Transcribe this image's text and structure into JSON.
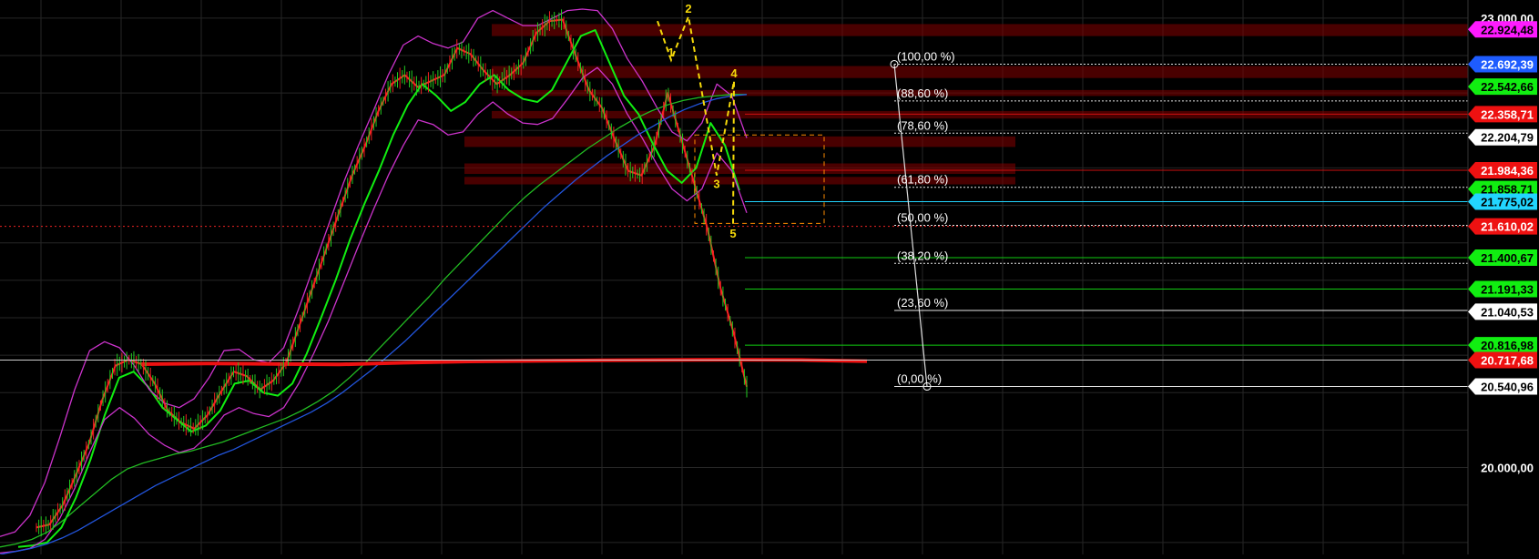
{
  "chart_data": {
    "type": "line",
    "title": "",
    "xlabel": "",
    "ylabel": "",
    "ylim": [
      19420,
      23060
    ],
    "grid": true,
    "axis_ticks": [
      {
        "value": 23000.0,
        "label": "23.000,00"
      },
      {
        "value": 20000.0,
        "label": "20.000,00"
      }
    ],
    "price_tags": [
      {
        "value": 22924.48,
        "label": "22.924,48",
        "bg": "#ff1aff",
        "fg": "#000000"
      },
      {
        "value": 22692.39,
        "label": "22.692,39",
        "bg": "#1e5cff",
        "fg": "#ffffff"
      },
      {
        "value": 22542.66,
        "label": "22.542,66",
        "bg": "#11ee11",
        "fg": "#000000"
      },
      {
        "value": 22358.71,
        "label": "22.358,71",
        "bg": "#ee1111",
        "fg": "#ffffff"
      },
      {
        "value": 22204.79,
        "label": "22.204,79",
        "bg": "#ffffff",
        "fg": "#000000"
      },
      {
        "value": 21984.36,
        "label": "21.984,36",
        "bg": "#ee1111",
        "fg": "#ffffff"
      },
      {
        "value": 21858.71,
        "label": "21.858,71",
        "bg": "#11ee11",
        "fg": "#000000"
      },
      {
        "value": 21775.02,
        "label": "21.775,02",
        "bg": "#22d5ff",
        "fg": "#000000"
      },
      {
        "value": 21610.02,
        "label": "21.610,02",
        "bg": "#ee1111",
        "fg": "#ffffff"
      },
      {
        "value": 21400.67,
        "label": "21.400,67",
        "bg": "#11ee11",
        "fg": "#000000"
      },
      {
        "value": 21191.33,
        "label": "21.191,33",
        "bg": "#11ee11",
        "fg": "#000000"
      },
      {
        "value": 21040.53,
        "label": "21.040,53",
        "bg": "#ffffff",
        "fg": "#000000"
      },
      {
        "value": 20816.98,
        "label": "20.816,98",
        "bg": "#11ee11",
        "fg": "#000000"
      },
      {
        "value": 20717.68,
        "label": "20.717,68",
        "bg": "#ee1111",
        "fg": "#ffffff"
      },
      {
        "value": 20540.96,
        "label": "20.540,96",
        "bg": "#ffffff",
        "fg": "#000000"
      }
    ],
    "fibonacci": {
      "high": 22692.39,
      "low": 20540.96,
      "levels": [
        {
          "ratio": 1.0,
          "label": "(100,00 %)"
        },
        {
          "ratio": 0.886,
          "label": "(88,60 %)"
        },
        {
          "ratio": 0.786,
          "label": "(78,60 %)"
        },
        {
          "ratio": 0.618,
          "label": "(61,80 %)"
        },
        {
          "ratio": 0.5,
          "label": "(50,00 %)"
        },
        {
          "ratio": 0.382,
          "label": "(38,20 %)"
        },
        {
          "ratio": 0.236,
          "label": "(23,60 %)"
        },
        {
          "ratio": 0.0,
          "label": "(0,00 %)"
        }
      ]
    },
    "horizontal_lines": [
      {
        "value": 22358.71,
        "color": "#cc1111"
      },
      {
        "value": 21984.36,
        "color": "#cc1111"
      },
      {
        "value": 21775.02,
        "color": "#22d5ff"
      },
      {
        "value": 21610.02,
        "color": "#ee2222",
        "dotted": true
      },
      {
        "value": 21400.67,
        "color": "#11cc11"
      },
      {
        "value": 21191.33,
        "color": "#11cc11"
      },
      {
        "value": 20816.98,
        "color": "#11cc11"
      },
      {
        "value": 20717.68,
        "color": "#cccccc"
      }
    ],
    "resistance_zones": [
      {
        "from": 22880,
        "to": 22960
      },
      {
        "from": 22600,
        "to": 22680
      },
      {
        "from": 22480,
        "to": 22520
      },
      {
        "from": 22330,
        "to": 22380
      },
      {
        "from": 22140,
        "to": 22210
      },
      {
        "from": 21960,
        "to": 22030
      },
      {
        "from": 21890,
        "to": 21940
      }
    ],
    "wave_labels": [
      {
        "label": "1",
        "value": 22720
      },
      {
        "label": "2",
        "value": 23010
      },
      {
        "label": "3",
        "value": 21950
      },
      {
        "label": "4",
        "value": 22580
      },
      {
        "label": "5",
        "value": 21620
      }
    ],
    "series": [
      {
        "color": "#ff2222",
        "values": [
          19600,
          19620,
          19750,
          19950,
          20160,
          20450,
          20680,
          20720,
          20690,
          20560,
          20380,
          20300,
          20260,
          20350,
          20500,
          20640,
          20610,
          20520,
          20580,
          20700,
          20950,
          21200,
          21450,
          21700,
          21950,
          22150,
          22380,
          22560,
          22620,
          22540,
          22580,
          22620,
          22800,
          22760,
          22650,
          22560,
          22620,
          22700,
          22900,
          22980,
          22990,
          22750,
          22520,
          22400,
          22180,
          21980,
          21950,
          22150,
          22500,
          22200,
          21900,
          21600,
          21200,
          20900,
          20540
        ]
      },
      {
        "color": "#11ee11",
        "values": [
          19470,
          19480,
          19500,
          19600,
          19800,
          20050,
          20350,
          20600,
          20640,
          20540,
          20400,
          20320,
          20240,
          20280,
          20380,
          20560,
          20580,
          20500,
          20480,
          20560,
          20760,
          21000,
          21250,
          21520,
          21760,
          21980,
          22220,
          22420,
          22560,
          22480,
          22380,
          22440,
          22560,
          22620,
          22520,
          22460,
          22440,
          22520,
          22700,
          22880,
          22920,
          22700,
          22480,
          22360,
          22160,
          21980,
          21900,
          22000,
          22300,
          22150,
          21850
        ]
      },
      {
        "color": "#cc33cc",
        "values": [
          19540,
          19570,
          19680,
          19900,
          20200,
          20520,
          20780,
          20840,
          20800,
          20680,
          20520,
          20430,
          20400,
          20460,
          20600,
          20780,
          20790,
          20720,
          20700,
          20800,
          21060,
          21340,
          21620,
          21900,
          22150,
          22380,
          22620,
          22820,
          22880,
          22830,
          22800,
          22840,
          23000,
          23050,
          23000,
          22950,
          22950,
          23000,
          23050,
          23060,
          23050,
          22930,
          22730,
          22580,
          22400,
          22240,
          22180,
          22300,
          22560,
          22480,
          22200
        ]
      },
      {
        "color": "#cc33cc",
        "values": [
          19430,
          19440,
          19460,
          19520,
          19660,
          19860,
          20100,
          20320,
          20400,
          20330,
          20220,
          20150,
          20100,
          20130,
          20220,
          20350,
          20400,
          20360,
          20340,
          20400,
          20560,
          20760,
          20980,
          21230,
          21480,
          21720,
          21950,
          22150,
          22320,
          22290,
          22220,
          22240,
          22360,
          22440,
          22360,
          22300,
          22290,
          22330,
          22460,
          22600,
          22670,
          22560,
          22360,
          22200,
          22020,
          21860,
          21780,
          21860,
          22100,
          21980,
          21700
        ]
      },
      {
        "color": "#22bb22",
        "values": [
          19470,
          19490,
          19520,
          19570,
          19650,
          19740,
          19830,
          19920,
          19990,
          20030,
          20060,
          20090,
          20110,
          20140,
          20170,
          20210,
          20250,
          20290,
          20330,
          20380,
          20440,
          20510,
          20600,
          20700,
          20810,
          20920,
          21030,
          21140,
          21260,
          21370,
          21480,
          21590,
          21700,
          21800,
          21890,
          21970,
          22050,
          22130,
          22200,
          22270,
          22330,
          22380,
          22420,
          22450,
          22470,
          22480,
          22490,
          22490
        ]
      },
      {
        "color": "#2255dd",
        "values": [
          19420,
          19440,
          19460,
          19490,
          19530,
          19580,
          19640,
          19700,
          19760,
          19820,
          19880,
          19930,
          19980,
          20030,
          20080,
          20120,
          20170,
          20220,
          20270,
          20320,
          20370,
          20430,
          20500,
          20580,
          20660,
          20750,
          20840,
          20940,
          21040,
          21140,
          21240,
          21340,
          21440,
          21540,
          21640,
          21740,
          21830,
          21920,
          22000,
          22080,
          22150,
          22220,
          22280,
          22340,
          22390,
          22430,
          22460,
          22480,
          22490
        ]
      },
      {
        "color": "#ee1111",
        "values": [
          20690,
          20695,
          20692,
          20688,
          20700,
          20708,
          20712,
          20716,
          20718,
          20720,
          20718,
          20710
        ]
      }
    ]
  }
}
